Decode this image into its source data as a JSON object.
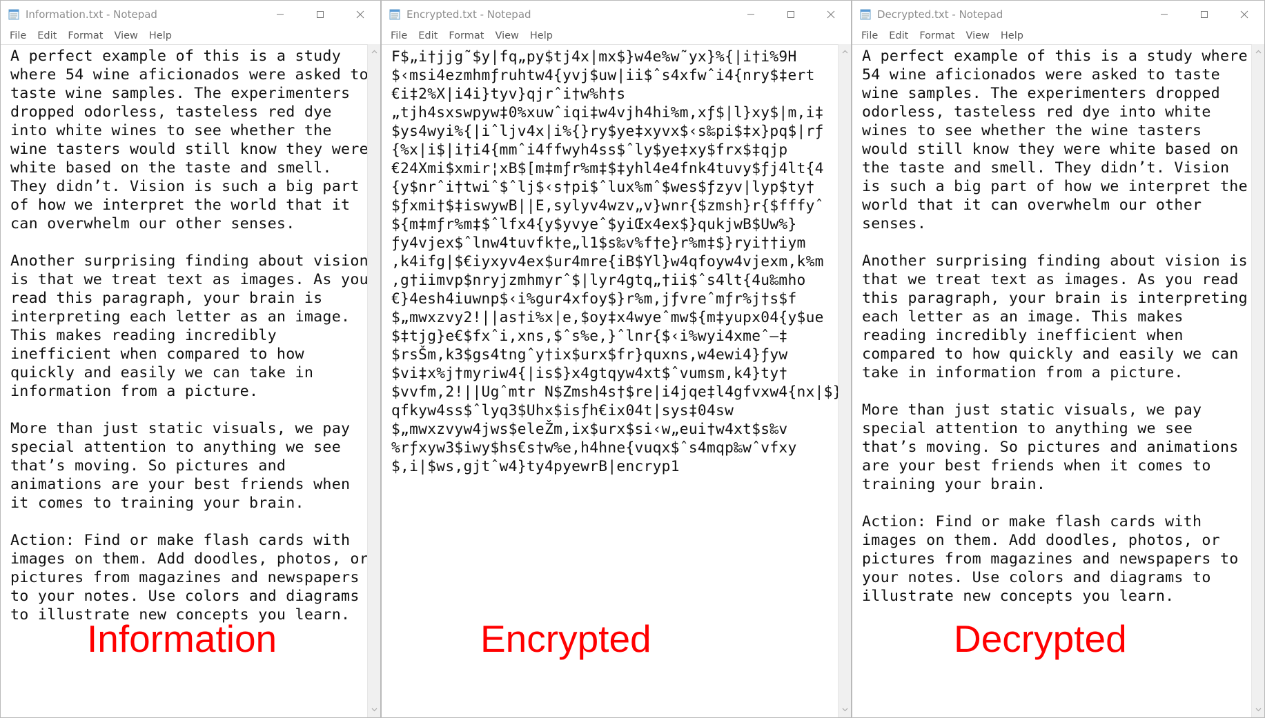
{
  "menu": [
    "File",
    "Edit",
    "Format",
    "View",
    "Help"
  ],
  "windows": [
    {
      "title": "Information.txt - Notepad",
      "text": "A perfect example of this is a study\nwhere 54 wine aficionados were asked to\ntaste wine samples. The experimenters\ndropped odorless, tasteless red dye\ninto white wines to see whether the\nwine tasters would still know they were\nwhite based on the taste and smell.\nThey didn’t. Vision is such a big part\nof how we interpret the world that it\ncan overwhelm our other senses.\n\nAnother surprising finding about vision\nis that we treat text as images. As you\nread this paragraph, your brain is\ninterpreting each letter as an image.\nThis makes reading incredibly\ninefficient when compared to how\nquickly and easily we can take in\ninformation from a picture.\n\nMore than just static visuals, we pay\nspecial attention to anything we see\nthat’s moving. So pictures and\nanimations are your best friends when\nit comes to training your brain.\n\nAction: Find or make flash cards with\nimages on them. Add doodles, photos, or\npictures from magazines and newspapers\nto your notes. Use colors and diagrams\nto illustrate new concepts you learn.",
      "caption": "Information"
    },
    {
      "title": "Encrypted.txt - Notepad",
      "text": "F$„i†jjg˜$y|fq„py$tj4x|mx$}w4e%w˜yx}%{|i†i%9H\n$‹msi4ezmhmƒruhtw4{yvj$uw|ii$ˆs4xfwˆi4{nry$‡ert\n€i‡2%X|i4i}tyv}qjrˆi†w%h†s\n„tjh4sxswpyw‡0%xuwˆiqi‡w4vjh4hi%m,xƒ$|l}xy$|m,i‡\n$ys4wyi%{|iˆljv4x|i%{}ry$ye‡xyvx$‹s‰pi$‡x}pq$|rƒ\n{%x|i$|i†i4{mmˆi4ffwyh4ss$ˆly$ye‡xy$frx$‡qjp\n€24Xmi$xmir¦xB$[m‡mƒr%m‡$‡yhl4e4fnk4tuvy$ƒj4lt{4\n{y$nrˆi†twiˆ$ˆlj$‹s†pi$ˆlux%mˆ$wes$ƒzyv|lyp$ty†\n$ƒxmi†$‡iswywB||E,sylyv4wzv„v}wnr{$zmsh}r{$fffyˆ\n${m‡mƒr%m‡$ˆlfx4{y$yvyeˆ$yiŒx4ex$}qukjwB$Uw%}\nƒy4vjex$ˆlnw4tuvfk†e„l1$s‰v%f†e}r%m‡$}ryi††iym\n,k4ifg|$€iyxyv4ex$ur4mre{iB$Yl}w4qfoyw4vjexm,k%m\n,g†iimvp$nryjzmhmyrˆ$|lyr4gtq„†ii$ˆs4lt{4u‰mho\n€}4esh4iuwnp$‹i%gur4xfoy$}r%m,jƒvreˆmƒr%j†s$f\n$„mwxzvy2!||as†i%x|e,$oy‡x4wyeˆmw${m‡yupx04{y$ue\n$‡tjg}e€$fxˆi,xns,$ˆs%e,}ˆlnr{$‹i%wyi4xmeˆ–‡\n$rsŠm,k3$gs4tngˆy†ix$urx$fr}quxns,w4ewi4}ƒyw\n$vi‡x%j†myriw4{|is$}x4gtqyw4xt$ˆvumsm,k4}ty†\n$vvfm,2!||Ugˆmtr N$Zmsh4s†$re|i4jqe‡l4gfvxw4{nx|$}\nqfkyw4ss$ˆlyq3$Uhx$isƒh€ix04t|sys‡04sw\n$„mwxzvyw4jws$eleŽm,ix$urx$si‹w„eui†w4xt$s‰v\n%rƒxyw3$iwy$hs€s†w%e,h4hne{vuqx$ˆs4mqp‰wˆvfxy\n$,i|$ws,gjtˆw4}ty4pyewrB|encryp1",
      "caption": "Encrypted"
    },
    {
      "title": "Decrypted.txt - Notepad",
      "text": "A perfect example of this is a study where\n54 wine aficionados were asked to taste\nwine samples. The experimenters dropped\nodorless, tasteless red dye into white\nwines to see whether the wine tasters\nwould still know they were white based on\nthe taste and smell. They didn’t. Vision\nis such a big part of how we interpret the\nworld that it can overwhelm our other\nsenses.\n\nAnother surprising finding about vision is\nthat we treat text as images. As you read\nthis paragraph, your brain is interpreting\neach letter as an image. This makes\nreading incredibly inefficient when\ncompared to how quickly and easily we can\ntake in information from a picture.\n\nMore than just static visuals, we pay\nspecial attention to anything we see\nthat’s moving. So pictures and animations\nare your best friends when it comes to\ntraining your brain.\n\nAction: Find or make flash cards with\nimages on them. Add doodles, photos, or\npictures from magazines and newspapers to\nyour notes. Use colors and diagrams to\nillustrate new concepts you learn.",
      "caption": "Decrypted"
    }
  ],
  "icons": {
    "app": "notepad-icon",
    "minimize": "minimize-icon",
    "maximize": "maximize-icon",
    "close": "close-icon"
  },
  "colors": {
    "caption": "#ff0000",
    "title_text": "#8c8c8c"
  }
}
